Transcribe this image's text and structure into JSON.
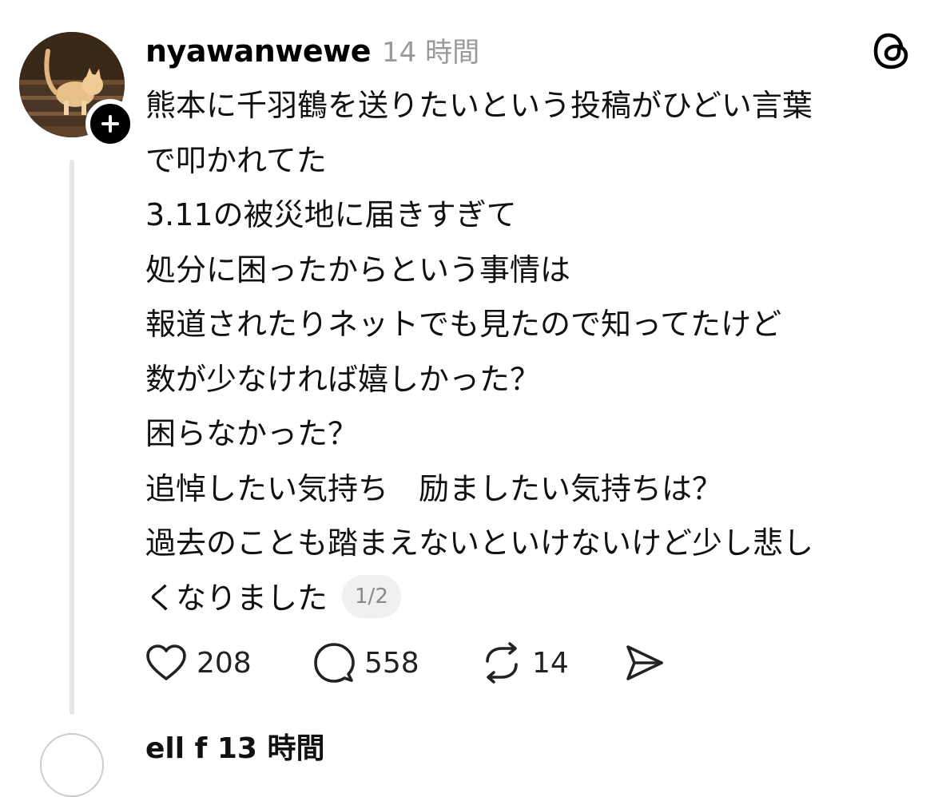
{
  "post": {
    "username": "nyawanwewe",
    "timestamp": "14 時間",
    "lines": [
      "熊本に千羽鶴を送りたいという投稿がひどい言葉",
      "で叩かれてた",
      "3.11の被災地に届きすぎて",
      "処分に困ったからという事情は",
      "報道されたりネットでも見たので知ってたけど",
      "数が少なければ嬉しかった？",
      "困らなかった？",
      "追悼したい気持ち　励ましたい気持ちは？",
      "過去のことも踏まえないといけないけど少し悲し",
      "くなりました"
    ],
    "pager": "1/2",
    "actions": {
      "likes": "208",
      "replies": "558",
      "reposts": "14"
    }
  },
  "next_post": {
    "username_partial": "ell f 13 時間"
  },
  "icons": {
    "follow": "plus-icon",
    "app": "threads-logo-icon",
    "like": "heart-icon",
    "reply": "comment-icon",
    "repost": "repost-icon",
    "share": "send-icon"
  }
}
